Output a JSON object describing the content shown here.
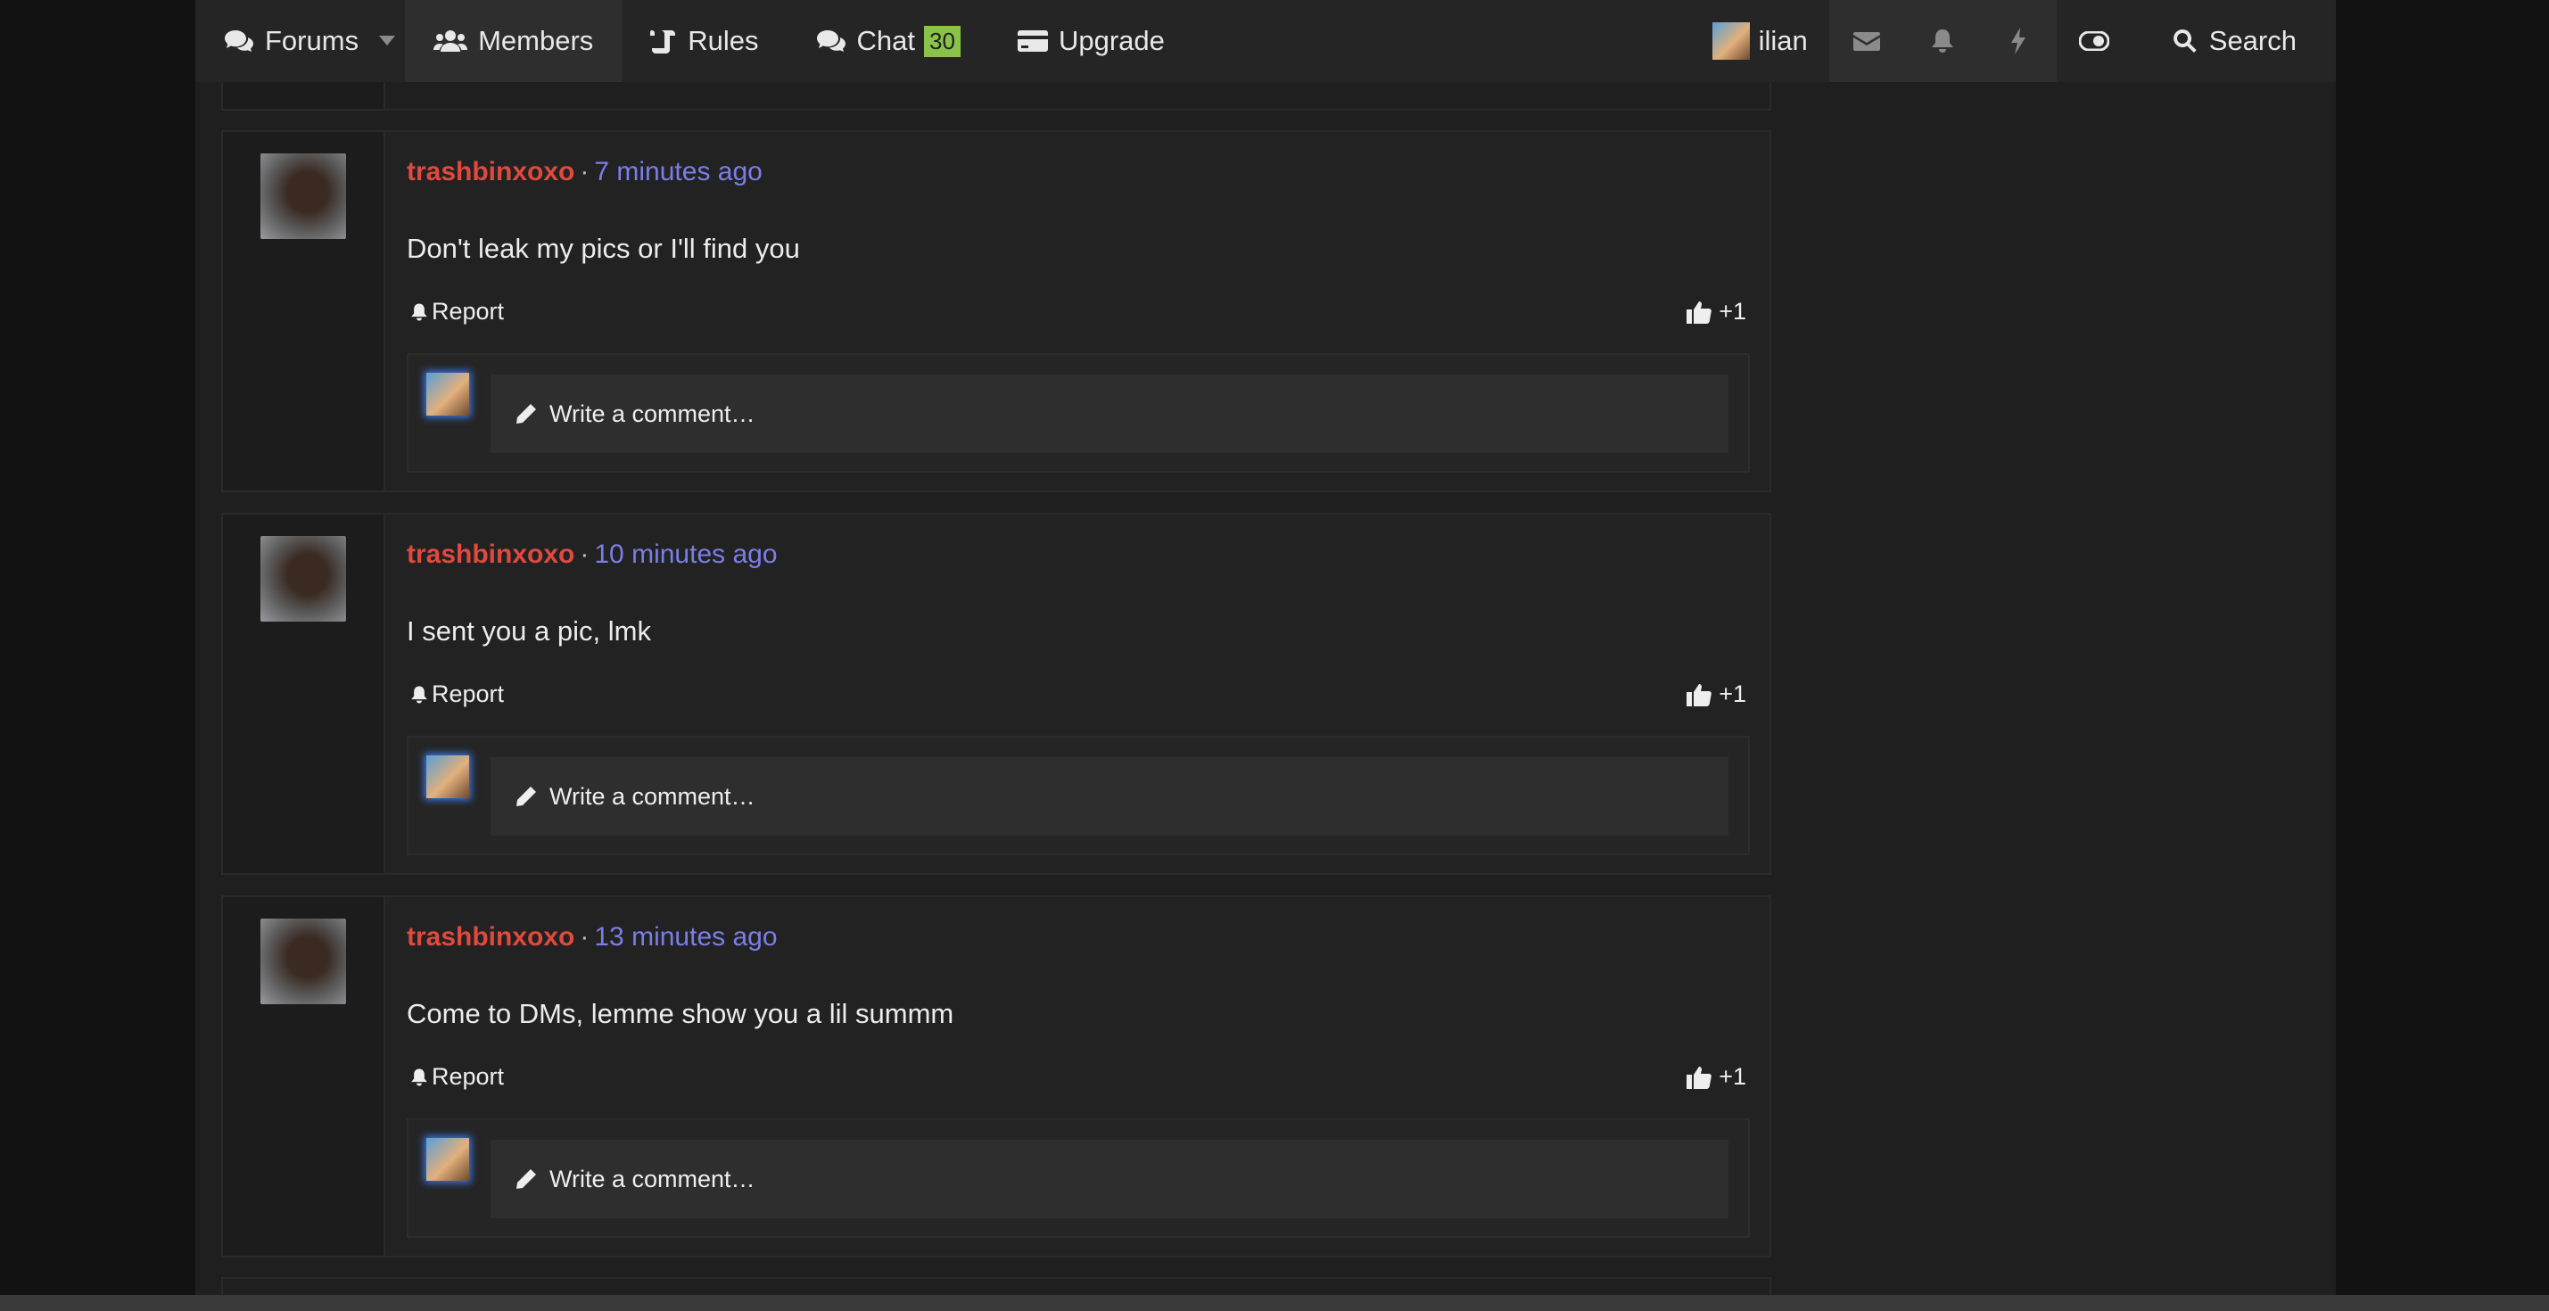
{
  "nav": {
    "forums": "Forums",
    "members": "Members",
    "rules": "Rules",
    "chat": "Chat",
    "chat_badge": "30",
    "upgrade": "Upgrade",
    "username": "ilian",
    "search": "Search"
  },
  "posts": [
    {
      "author": "trashbinxoxo",
      "separator": "·",
      "time": "7 minutes ago",
      "text": "Don't leak my pics or I'll find you",
      "report": "Report",
      "likes": "+1",
      "comment_placeholder": "Write a comment…"
    },
    {
      "author": "trashbinxoxo",
      "separator": "·",
      "time": "10 minutes ago",
      "text": "I sent you a pic, lmk",
      "report": "Report",
      "likes": "+1",
      "comment_placeholder": "Write a comment…"
    },
    {
      "author": "trashbinxoxo",
      "separator": "·",
      "time": "13 minutes ago",
      "text": "Come to DMs, lemme show you a lil summm",
      "report": "Report",
      "likes": "+1",
      "comment_placeholder": "Write a comment…"
    }
  ],
  "colors": {
    "author": "#e0493e",
    "time": "#7b7ee8",
    "badge": "#8bc34a",
    "background": "#1f1f1f"
  }
}
